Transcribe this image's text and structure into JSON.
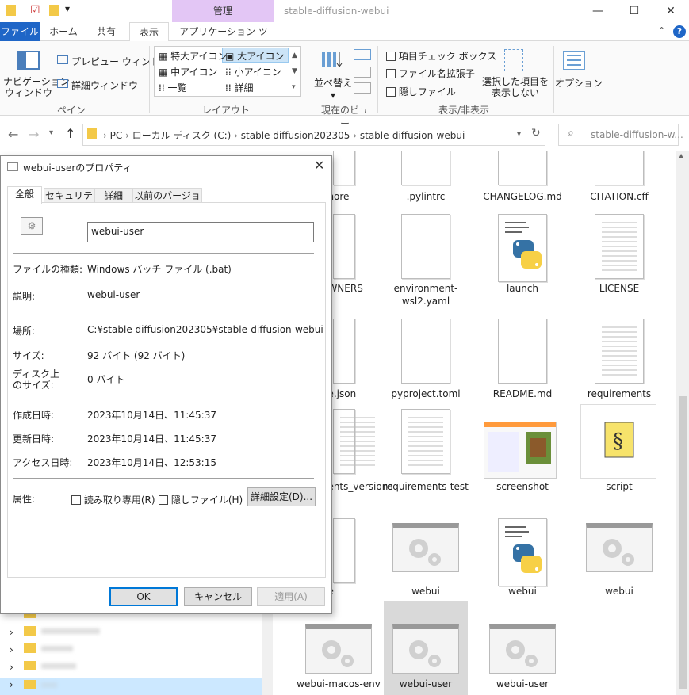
{
  "window": {
    "title": "stable-diffusion-webui",
    "context_tab": "管理",
    "controls": [
      "—",
      "☐",
      "✕"
    ]
  },
  "ribbon_tabs": [
    "ファイル",
    "ホーム",
    "共有",
    "表示",
    "アプリケーション ツール"
  ],
  "ribbon": {
    "pane_group": {
      "nav_pane": "ナビゲーション\nウィンドウ",
      "preview": "プレビュー ウィンドウ",
      "details": "詳細ウィンドウ",
      "label": "ペイン"
    },
    "layout_group": {
      "items": [
        "特大アイコン",
        "大アイコン",
        "中アイコン",
        "小アイコン",
        "一覧",
        "詳細"
      ],
      "selected": "大アイコン",
      "label": "レイアウト"
    },
    "current_view_group": {
      "sort": "並べ替え",
      "label": "現在のビュー"
    },
    "show_hide_group": {
      "checkboxes": [
        "項目チェック ボックス",
        "ファイル名拡張子",
        "隠しファイル"
      ],
      "hide_selected": "選択した項目を\n表示しない",
      "label": "表示/非表示"
    },
    "options": "オプション"
  },
  "address": {
    "crumbs": [
      "PC",
      "ローカル ディスク (C:)",
      "stable diffusion202305",
      "stable-diffusion-webui"
    ],
    "search_placeholder": "stable-diffusion-w..."
  },
  "files": [
    {
      "name": "...nore",
      "type": "doc"
    },
    {
      "name": ".pylintrc",
      "type": "doc"
    },
    {
      "name": "CHANGELOG.md",
      "type": "doc"
    },
    {
      "name": "CITATION.cff",
      "type": "doc"
    },
    {
      "name": "...WNERS",
      "type": "doc"
    },
    {
      "name": "environment-wsl2.yaml",
      "type": "doc"
    },
    {
      "name": "launch",
      "type": "python"
    },
    {
      "name": "LICENSE",
      "type": "lines"
    },
    {
      "name": "...e.json",
      "type": "doc"
    },
    {
      "name": "pyproject.toml",
      "type": "doc"
    },
    {
      "name": "README.md",
      "type": "doc"
    },
    {
      "name": "requirements",
      "type": "lines"
    },
    {
      "name": "...ents_versions",
      "type": "lines"
    },
    {
      "name": "requirements-test",
      "type": "lines"
    },
    {
      "name": "screenshot",
      "type": "image"
    },
    {
      "name": "script",
      "type": "script"
    },
    {
      "name": "...e",
      "type": "doc"
    },
    {
      "name": "webui",
      "type": "gear"
    },
    {
      "name": "webui",
      "type": "python"
    },
    {
      "name": "webui",
      "type": "gear"
    },
    {
      "name": "webui-macos-env",
      "type": "gear"
    },
    {
      "name": "webui-user",
      "type": "gear",
      "selected": true
    },
    {
      "name": "webui-user",
      "type": "gear"
    }
  ],
  "tree": {
    "items": [
      "2016....",
      "...",
      "...",
      "...",
      "..."
    ]
  },
  "dialog": {
    "title": "webui-userのプロパティ",
    "tabs": [
      "全般",
      "セキュリティ",
      "詳細",
      "以前のバージョン"
    ],
    "name_value": "webui-user",
    "rows": [
      {
        "label": "ファイルの種類:",
        "value": "Windows バッチ ファイル (.bat)"
      },
      {
        "label": "説明:",
        "value": "webui-user"
      },
      {
        "label": "場所:",
        "value": "C:¥stable diffusion202305¥stable-diffusion-webui"
      },
      {
        "label": "サイズ:",
        "value": "92 バイト (92 バイト)"
      },
      {
        "label": "ディスク上\nのサイズ:",
        "value": "0 バイト"
      },
      {
        "label": "作成日時:",
        "value": "2023年10月14日、11:45:37"
      },
      {
        "label": "更新日時:",
        "value": "2023年10月14日、11:45:37"
      },
      {
        "label": "アクセス日時:",
        "value": "2023年10月14日、12:53:15"
      }
    ],
    "attributes": {
      "label": "属性:",
      "readonly": "読み取り専用(R)",
      "hidden": "隠しファイル(H)",
      "advanced": "詳細設定(D)..."
    },
    "buttons": {
      "ok": "OK",
      "cancel": "キャンセル",
      "apply": "適用(A)"
    }
  }
}
